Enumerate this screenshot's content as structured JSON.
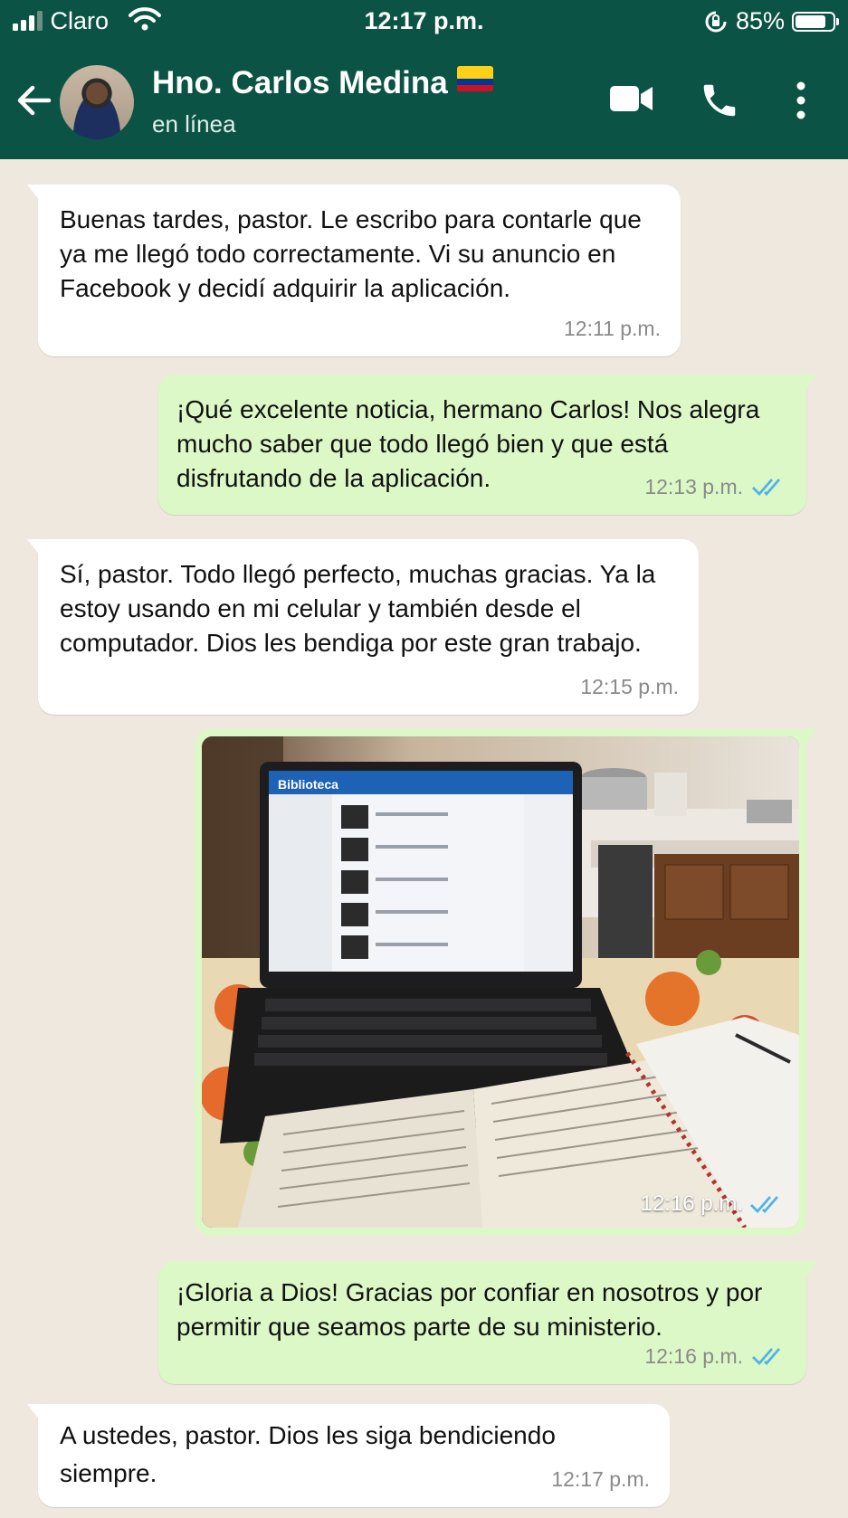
{
  "status_bar": {
    "carrier": "Claro",
    "time": "12:17 p.m.",
    "battery": "85%",
    "battery_level": 0.85
  },
  "header": {
    "contact_name": "Hno. Carlos Medina",
    "status": "en línea"
  },
  "messages": [
    {
      "direction": "in",
      "text": "Buenas tardes, pastor. Le escribo para contarle que ya me llegó todo correctamente. Vi su anuncio en Facebook y decidí adquirir la aplicación.",
      "time": "12:11 p.m."
    },
    {
      "direction": "out",
      "text": "¡Qué excelente noticia, hermano Carlos! Nos alegra mucho saber que todo llegó bien y que está disfrutando de la aplicación.",
      "time": "12:13 p.m.",
      "read": true
    },
    {
      "direction": "in",
      "text": "Sí, pastor. Todo llegó perfecto, muchas gracias. Ya la estoy usando en mi celular y también desde el computador. Dios les bendiga por este gran trabajo.",
      "time": "12:15 p.m."
    },
    {
      "direction": "out",
      "type": "image",
      "time": "12:16 p.m.",
      "read": true,
      "image_text": {
        "screen_title": "Biblioteca"
      }
    },
    {
      "direction": "out",
      "text": "¡Gloria a Dios! Gracias por confiar en nosotros y por permitir que seamos parte de su ministerio.",
      "time": "12:16 p.m.",
      "read": true
    },
    {
      "direction": "in",
      "text": "A ustedes, pastor. Dios les siga bendiciendo siempre.",
      "time": "12:17 p.m."
    }
  ],
  "colors": {
    "header_bg": "#0b5345",
    "chat_bg": "#efe8de",
    "outgoing_bubble": "#dcf8c6",
    "incoming_bubble": "#ffffff",
    "read_ticks": "#4fb3e8"
  },
  "icons": [
    "signal-icon",
    "wifi-icon",
    "rotation-lock-icon",
    "battery-icon",
    "back-arrow-icon",
    "video-call-icon",
    "phone-icon",
    "more-vert-icon",
    "double-check-icon"
  ]
}
